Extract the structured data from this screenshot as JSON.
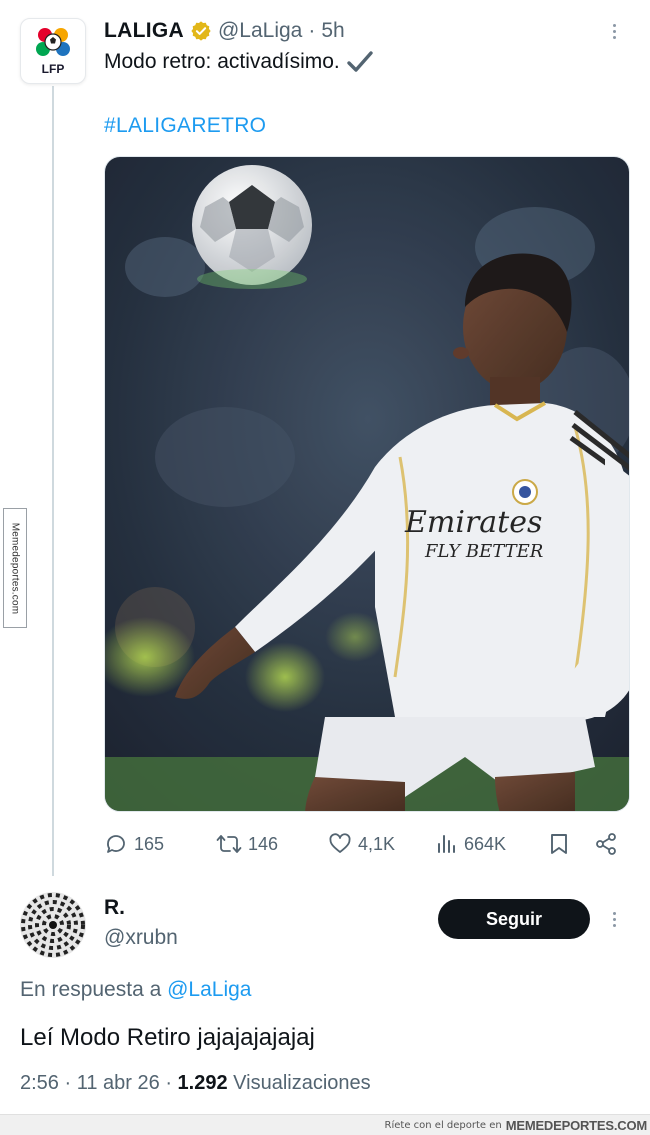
{
  "watermark_side": "Memedeportes.com",
  "tweet": {
    "name": "LALIGA",
    "handle": "@LaLiga",
    "dot": "·",
    "time": "5h",
    "text": "Modo retro: activadísimo.",
    "hashtag": "#LALIGARETRO",
    "avatar_label": "LFP",
    "stats": {
      "replies": "165",
      "retweets": "146",
      "likes": "4,1K",
      "views": "664K"
    }
  },
  "reply": {
    "name": "R.",
    "handle": "@xrubn",
    "follow_label": "Seguir",
    "reply_prefix": "En respuesta a",
    "reply_mention": "@LaLiga",
    "text": "Leí Modo Retiro jajajajajajaj",
    "time": "2:56",
    "date": "11 abr 26",
    "views_count": "1.292",
    "views_label": "Visualizaciones"
  },
  "footer": {
    "tagline": "Ríete con el deporte en",
    "brand": "MEMEDEPORTES.COM"
  },
  "colors": {
    "accent": "#1d9bf0",
    "verified": "#e2b719",
    "text": "#0f1419",
    "muted": "#536471"
  },
  "icons": [
    "reply-icon",
    "retweet-icon",
    "like-icon",
    "views-icon",
    "bookmark-icon",
    "share-icon",
    "verified-badge-icon",
    "checkmark-icon",
    "more-icon"
  ]
}
